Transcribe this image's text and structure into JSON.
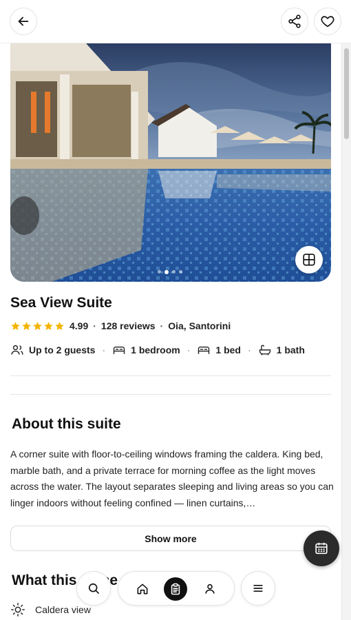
{
  "header": {
    "back_icon": "arrow-left-icon",
    "share_icon": "share-icon",
    "favorite_icon": "heart-icon"
  },
  "gallery": {
    "image_alt": "Resort pool at dusk",
    "dot_count": 4,
    "active_dot": 1,
    "grid_icon": "grid-icon"
  },
  "listing": {
    "title": "Sea View Suite",
    "stars": 5,
    "star_color": "#f5b400",
    "rating": "4.99",
    "reviews": "128 reviews",
    "location": "Oia, Santorini",
    "guests": "Up to 2 guests",
    "bedrooms": "1 bedroom",
    "beds": "1 bed",
    "baths": "1 bath"
  },
  "about": {
    "heading": "About this suite",
    "body": "A corner suite with floor-to-ceiling windows framing the caldera. King bed, marble bath, and a private terrace for morning coffee as the light moves across the water. The layout separates sleeping and living areas so you can linger indoors without feeling confined — linen curtains,…",
    "show_more": "Show more"
  },
  "offers": {
    "heading": "What this place offers",
    "items": [
      {
        "label": "Caldera view",
        "icon": "sun-icon"
      }
    ]
  },
  "fab": {
    "icon": "calendar-icon"
  },
  "bottom_nav": {
    "search_icon": "search-icon",
    "home_icon": "home-icon",
    "trips_icon": "clipboard-icon",
    "profile_icon": "user-icon",
    "menu_icon": "menu-icon",
    "active": "trips"
  }
}
